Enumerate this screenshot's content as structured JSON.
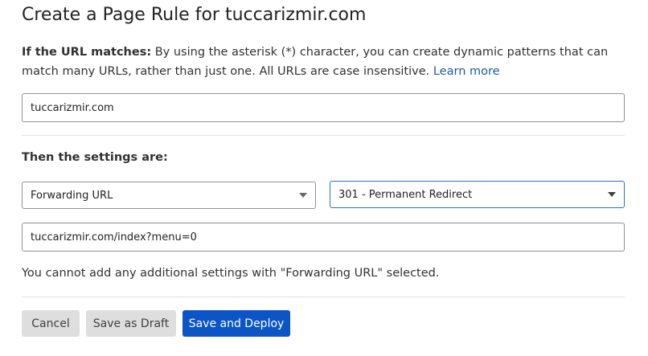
{
  "page": {
    "title": "Create a Page Rule for tuccarizmir.com"
  },
  "url_match": {
    "label": "If the URL matches:",
    "description": " By using the asterisk (*) character, you can create dynamic patterns that can match many URLs, rather than just one. All URLs are case insensitive. ",
    "learn_more": "Learn more",
    "value": "tuccarizmir.com"
  },
  "settings": {
    "label": "Then the settings are:",
    "setting_select": "Forwarding URL",
    "status_select": "301 - Permanent Redirect",
    "destination_value": "tuccarizmir.com/index?menu=0",
    "note": "You cannot add any additional settings with \"Forwarding URL\" selected."
  },
  "actions": {
    "cancel": "Cancel",
    "save_draft": "Save as Draft",
    "save_deploy": "Save and Deploy"
  },
  "colors": {
    "primary": "#0b55c7",
    "link": "#1a5aa6",
    "secondary_button": "#dedede",
    "focus_border": "#2c6ecb"
  },
  "icons": {
    "dropdown": "chevron-down-icon"
  }
}
